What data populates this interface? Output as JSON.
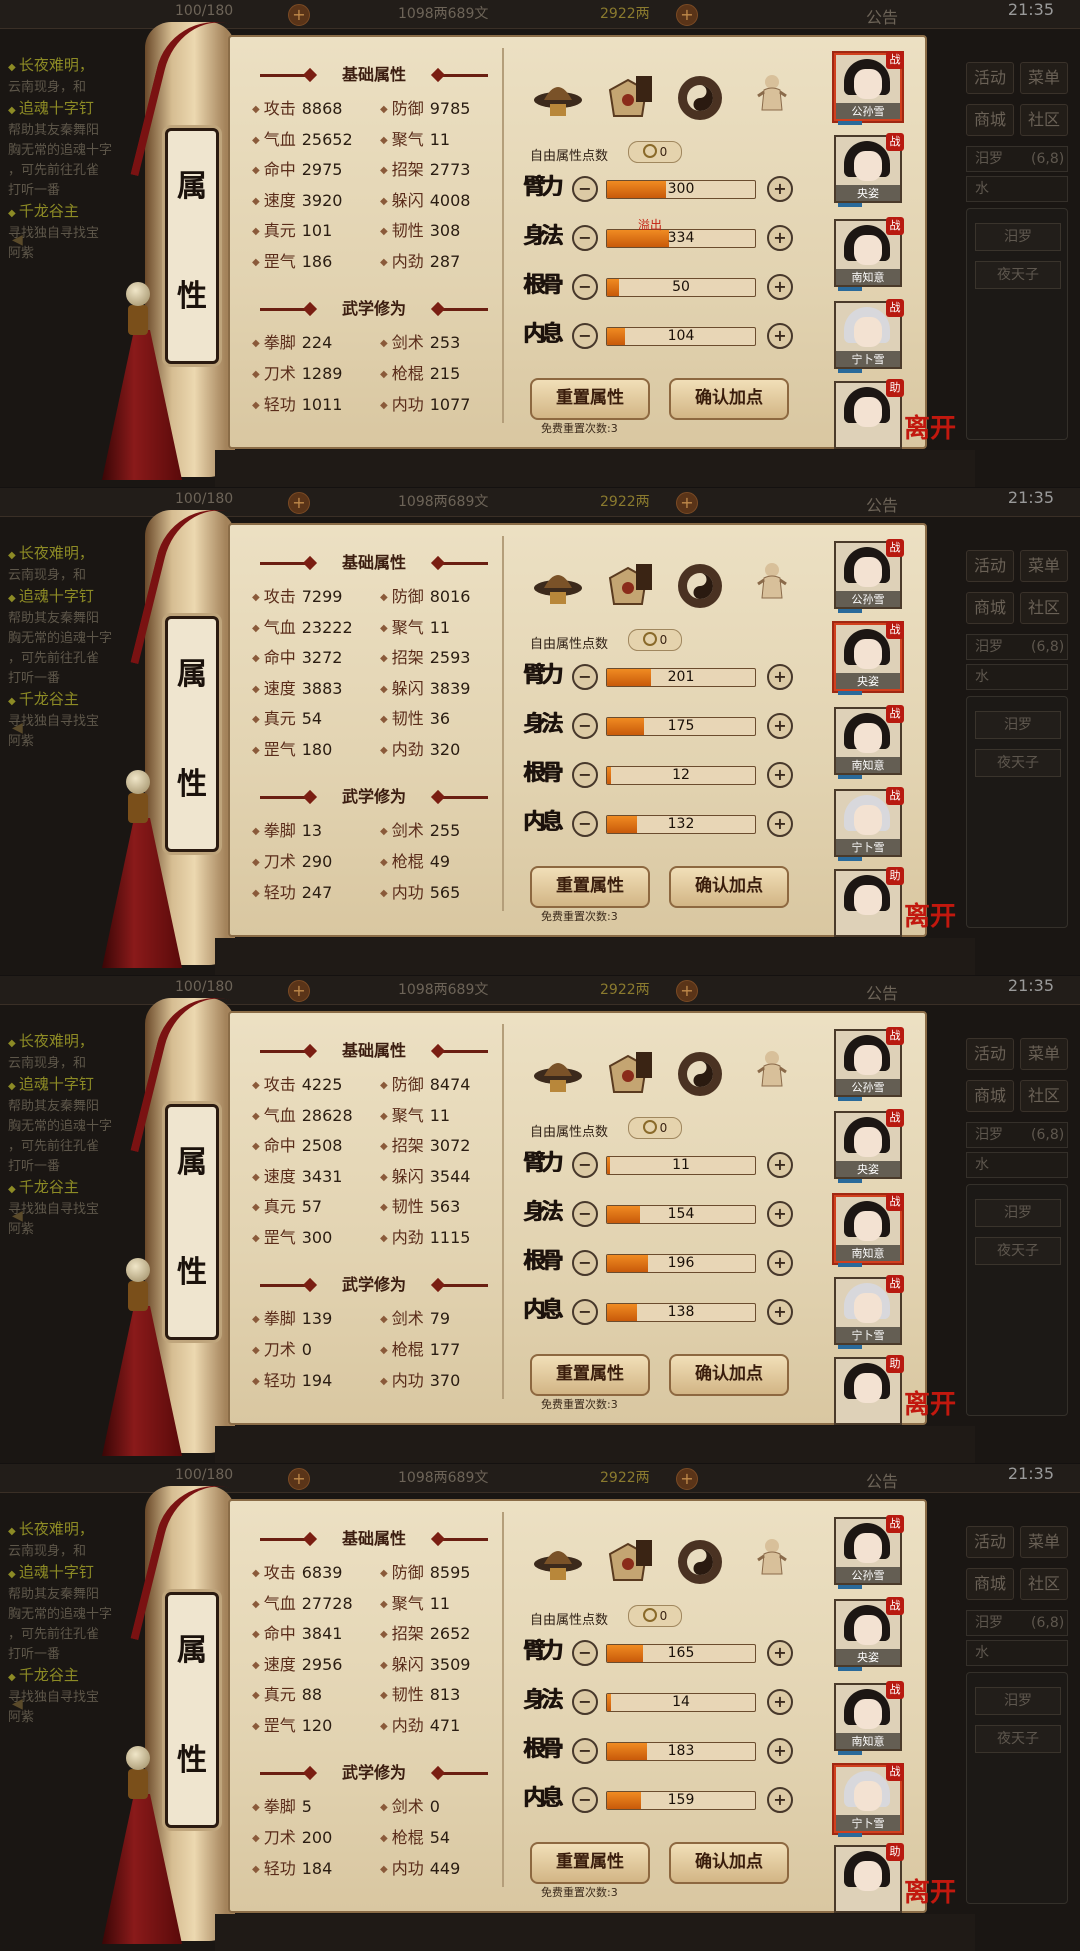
{
  "top_bar": {
    "stamina": "100/180",
    "silver": "1098两689文",
    "gold": "2922两",
    "notice": "公告",
    "clock": "21:35"
  },
  "quests": [
    {
      "title": "长夜难明，",
      "lines": [
        "云南现身，和"
      ]
    },
    {
      "title": "追魂十字钉",
      "lines": [
        "帮助其友秦舞阳",
        "胸无常的追魂十字",
        "，可先前往孔雀",
        "打听一番"
      ]
    },
    {
      "title": "千龙谷主",
      "lines": [
        "寻找独自寻找宝",
        "阿紫"
      ]
    }
  ],
  "right_menu": {
    "buttons": [
      "活动",
      "菜单",
      "商城",
      "社区"
    ],
    "row1": "汨罗",
    "row1_value": "(6,8)",
    "row2": "水",
    "list": [
      "汨罗",
      "夜天子"
    ]
  },
  "plaque": [
    "属",
    "性"
  ],
  "sections": {
    "basic": "基础属性",
    "martial": "武学修为"
  },
  "labels": {
    "free_points": "自由属性点数",
    "reset": "重置属性",
    "confirm": "确认加点",
    "free_resets": "免费重置次数:3",
    "overflow": "溢出",
    "leave": "离开",
    "minus": "−",
    "plus": "+"
  },
  "callig": [
    "臂力",
    "身法",
    "根骨",
    "内息"
  ],
  "characters": [
    {
      "name": "公孙雪",
      "badge": "战"
    },
    {
      "name": "央姿",
      "badge": "战"
    },
    {
      "name": "南知意",
      "badge": "战"
    },
    {
      "name": "宁卜雪",
      "badge": "战"
    },
    {
      "name": "",
      "badge": "助"
    }
  ],
  "panels": [
    {
      "basic_stats": [
        {
          "label": "攻击",
          "value": "8868"
        },
        {
          "label": "防御",
          "value": "9785"
        },
        {
          "label": "气血",
          "value": "25652"
        },
        {
          "label": "聚气",
          "value": "11"
        },
        {
          "label": "命中",
          "value": "2975"
        },
        {
          "label": "招架",
          "value": "2773"
        },
        {
          "label": "速度",
          "value": "3920"
        },
        {
          "label": "躲闪",
          "value": "4008"
        },
        {
          "label": "真元",
          "value": "101"
        },
        {
          "label": "韧性",
          "value": "308"
        },
        {
          "label": "罡气",
          "value": "186"
        },
        {
          "label": "内劲",
          "value": "287"
        }
      ],
      "martial_stats": [
        {
          "label": "拳脚",
          "value": "224"
        },
        {
          "label": "剑术",
          "value": "253"
        },
        {
          "label": "刀术",
          "value": "1289"
        },
        {
          "label": "枪棍",
          "value": "215"
        },
        {
          "label": "轻功",
          "value": "1011"
        },
        {
          "label": "内功",
          "value": "1077"
        }
      ],
      "free_points": "0",
      "attributes": [
        {
          "value": "300",
          "fill": 0.4
        },
        {
          "value": "334",
          "fill": 0.42,
          "overflow": true
        },
        {
          "value": "50",
          "fill": 0.08
        },
        {
          "value": "104",
          "fill": 0.12
        }
      ],
      "selected_character": 0
    },
    {
      "basic_stats": [
        {
          "label": "攻击",
          "value": "7299"
        },
        {
          "label": "防御",
          "value": "8016"
        },
        {
          "label": "气血",
          "value": "23222"
        },
        {
          "label": "聚气",
          "value": "11"
        },
        {
          "label": "命中",
          "value": "3272"
        },
        {
          "label": "招架",
          "value": "2593"
        },
        {
          "label": "速度",
          "value": "3883"
        },
        {
          "label": "躲闪",
          "value": "3839"
        },
        {
          "label": "真元",
          "value": "54"
        },
        {
          "label": "韧性",
          "value": "36"
        },
        {
          "label": "罡气",
          "value": "180"
        },
        {
          "label": "内劲",
          "value": "320"
        }
      ],
      "martial_stats": [
        {
          "label": "拳脚",
          "value": "13"
        },
        {
          "label": "剑术",
          "value": "255"
        },
        {
          "label": "刀术",
          "value": "290"
        },
        {
          "label": "枪棍",
          "value": "49"
        },
        {
          "label": "轻功",
          "value": "247"
        },
        {
          "label": "内功",
          "value": "565"
        }
      ],
      "free_points": "0",
      "attributes": [
        {
          "value": "201",
          "fill": 0.3
        },
        {
          "value": "175",
          "fill": 0.25
        },
        {
          "value": "12",
          "fill": 0.03
        },
        {
          "value": "132",
          "fill": 0.2
        }
      ],
      "selected_character": 1
    },
    {
      "basic_stats": [
        {
          "label": "攻击",
          "value": "4225"
        },
        {
          "label": "防御",
          "value": "8474"
        },
        {
          "label": "气血",
          "value": "28628"
        },
        {
          "label": "聚气",
          "value": "11"
        },
        {
          "label": "命中",
          "value": "2508"
        },
        {
          "label": "招架",
          "value": "3072"
        },
        {
          "label": "速度",
          "value": "3431"
        },
        {
          "label": "躲闪",
          "value": "3544"
        },
        {
          "label": "真元",
          "value": "57"
        },
        {
          "label": "韧性",
          "value": "563"
        },
        {
          "label": "罡气",
          "value": "300"
        },
        {
          "label": "内劲",
          "value": "1115"
        }
      ],
      "martial_stats": [
        {
          "label": "拳脚",
          "value": "139"
        },
        {
          "label": "剑术",
          "value": "79"
        },
        {
          "label": "刀术",
          "value": "0"
        },
        {
          "label": "枪棍",
          "value": "177"
        },
        {
          "label": "轻功",
          "value": "194"
        },
        {
          "label": "内功",
          "value": "370"
        }
      ],
      "free_points": "0",
      "attributes": [
        {
          "value": "11",
          "fill": 0.02
        },
        {
          "value": "154",
          "fill": 0.22
        },
        {
          "value": "196",
          "fill": 0.28
        },
        {
          "value": "138",
          "fill": 0.2
        }
      ],
      "selected_character": 2
    },
    {
      "basic_stats": [
        {
          "label": "攻击",
          "value": "6839"
        },
        {
          "label": "防御",
          "value": "8595"
        },
        {
          "label": "气血",
          "value": "27728"
        },
        {
          "label": "聚气",
          "value": "11"
        },
        {
          "label": "命中",
          "value": "3841"
        },
        {
          "label": "招架",
          "value": "2652"
        },
        {
          "label": "速度",
          "value": "2956"
        },
        {
          "label": "躲闪",
          "value": "3509"
        },
        {
          "label": "真元",
          "value": "88"
        },
        {
          "label": "韧性",
          "value": "813"
        },
        {
          "label": "罡气",
          "value": "120"
        },
        {
          "label": "内劲",
          "value": "471"
        }
      ],
      "martial_stats": [
        {
          "label": "拳脚",
          "value": "5"
        },
        {
          "label": "剑术",
          "value": "0"
        },
        {
          "label": "刀术",
          "value": "200"
        },
        {
          "label": "枪棍",
          "value": "54"
        },
        {
          "label": "轻功",
          "value": "184"
        },
        {
          "label": "内功",
          "value": "449"
        }
      ],
      "free_points": "0",
      "attributes": [
        {
          "value": "165",
          "fill": 0.24
        },
        {
          "value": "14",
          "fill": 0.03
        },
        {
          "value": "183",
          "fill": 0.27
        },
        {
          "value": "159",
          "fill": 0.23
        }
      ],
      "selected_character": 3
    }
  ],
  "colors": {
    "bar_fill": "#e07418",
    "accent_red": "#c2180e",
    "parchment": "#e6d8b8"
  }
}
